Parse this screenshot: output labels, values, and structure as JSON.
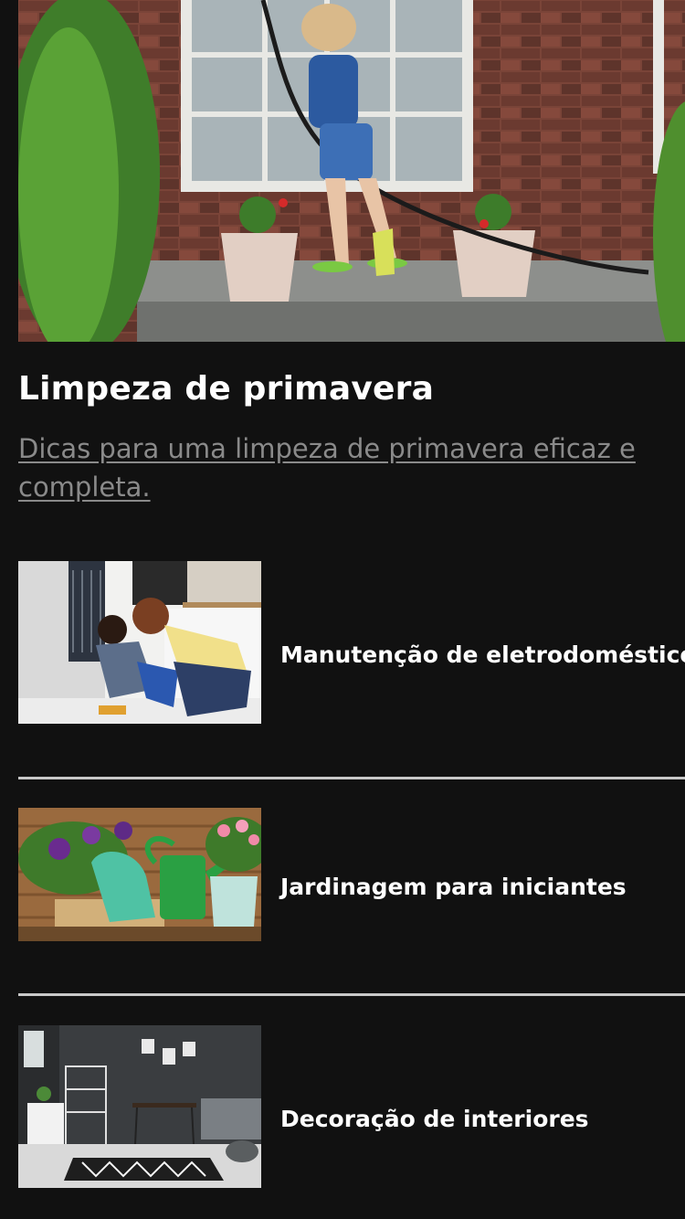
{
  "featured": {
    "title": "Limpeza de primavera",
    "subtitle": "Dicas para uma limpeza de primavera eficaz e completa.",
    "image_icon": "woman-washing-window-photo"
  },
  "articles": [
    {
      "title": "Manutenção de eletrodomésticos",
      "image_icon": "appliance-repair-photo"
    },
    {
      "title": "Jardinagem para iniciantes",
      "image_icon": "gardening-tools-photo"
    },
    {
      "title": "Decoração de interiores",
      "image_icon": "living-room-decor-photo"
    }
  ],
  "colors": {
    "background": "#111111",
    "text": "#ffffff",
    "link": "#8a8a8a",
    "divider": "#c8c8c8"
  }
}
